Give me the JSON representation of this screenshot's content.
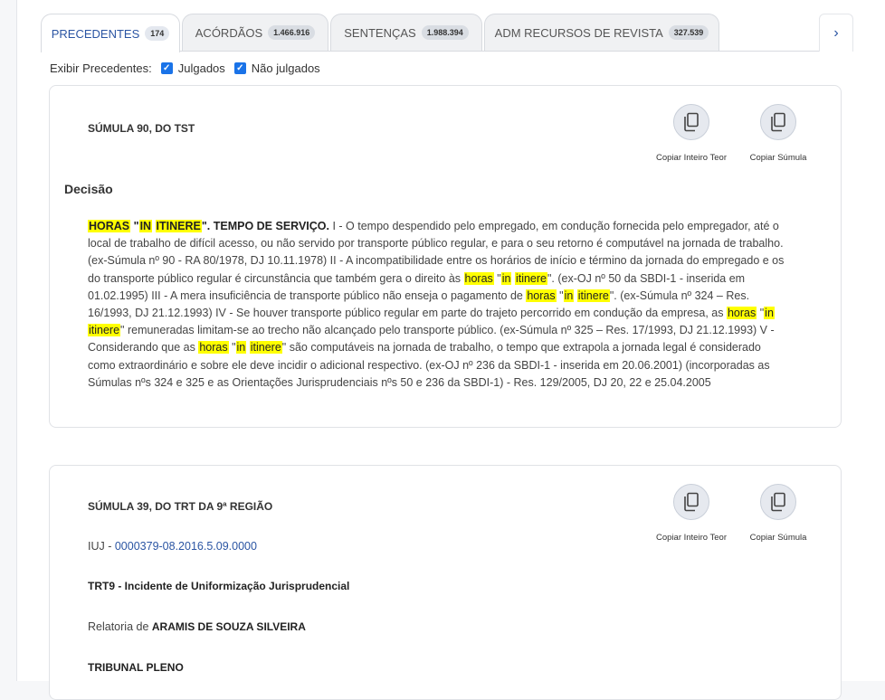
{
  "tabs": [
    {
      "label": "PRECEDENTES",
      "count": "174"
    },
    {
      "label": "ACÓRDÃOS",
      "count": "1.466.916"
    },
    {
      "label": "SENTENÇAS",
      "count": "1.988.394"
    },
    {
      "label": "ADM RECURSOS DE REVISTA",
      "count": "327.539"
    }
  ],
  "next_icon": "›",
  "filter": {
    "label": "Exibir Precedentes:",
    "opt1": "Julgados",
    "opt2": "Não julgados",
    "check": "✓"
  },
  "actions": {
    "copy_full": "Copiar Inteiro Teor",
    "copy_sumula": "Copiar Súmula"
  },
  "card1": {
    "title": "SÚMULA 90, DO TST",
    "heading": "Decisão",
    "hl_horas": "HORAS",
    "hl_in": "IN",
    "hl_itinere": "ITINERE",
    "head_rest": "\". TEMPO DE SERVIÇO.",
    "p1": " I - O tempo despendido pelo empregado, em condução fornecida pelo empregador, até o local de trabalho de difícil acesso, ou não servido por transporte público regular, e para o seu retorno é computável na jornada de trabalho. (ex-Súmula nº 90 - RA 80/1978, DJ 10.11.1978) II - A incompatibilidade entre os horários de início e término da jornada do empregado e os do transporte público regular é circunstância que também gera o direito às ",
    "w_horas": "horas",
    "w_in": "in",
    "w_itinere": "itinere",
    "p2": "\". (ex-OJ nº 50 da SBDI-1 - inserida em 01.02.1995) III - A mera insuficiência de transporte público não enseja o pagamento de ",
    "p3": "\". (ex-Súmula nº 324 – Res. 16/1993, DJ 21.12.1993) IV - Se houver transporte público regular em parte do trajeto percorrido em condução da empresa, as ",
    "p4": "\" remuneradas limitam-se ao trecho não alcançado pelo transporte público. (ex-Súmula nº 325 – Res. 17/1993, DJ 21.12.1993) V - Considerando que as ",
    "p5": "\" são computáveis na jornada de trabalho, o tempo que extrapola a jornada legal é considerado como extraordinário e sobre ele deve incidir o adicional respectivo. (ex-OJ nº 236 da SBDI-1 - inserida em 20.06.2001) (incorporadas as Súmulas nºs 324 e 325 e as Orientações Jurisprudenciais nºs 50 e 236 da SBDI-1) - Res. 129/2005, DJ 20, 22 e 25.04.2005"
  },
  "card2": {
    "title": "SÚMULA 39, DO TRT DA 9ª REGIÃO",
    "iuj_prefix": "IUJ - ",
    "iuj_link": "0000379-08.2016.5.09.0000",
    "trt": "TRT9 - Incidente de Uniformização Jurisprudencial",
    "rel_prefix": "Relatoria de ",
    "rel_name": "ARAMIS DE SOUZA SILVEIRA",
    "pleno": "TRIBUNAL PLENO"
  }
}
